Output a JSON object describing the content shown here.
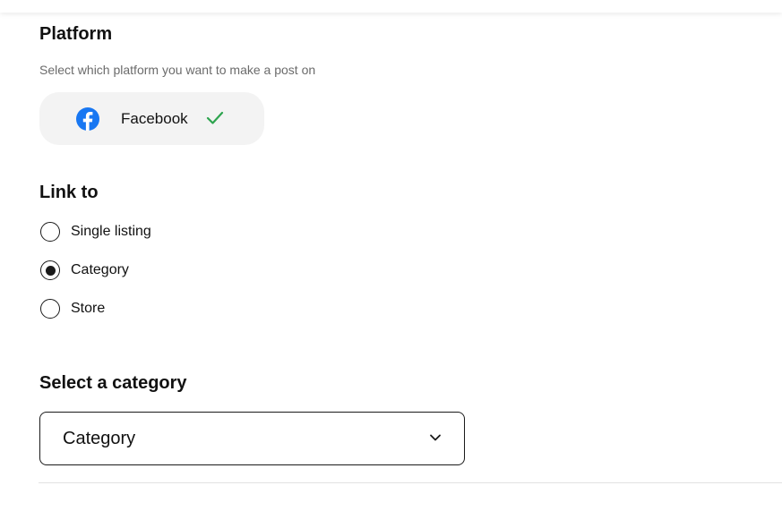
{
  "platform": {
    "heading": "Platform",
    "subtext": "Select which platform you want to make a post on",
    "selected_platform": {
      "label": "Facebook",
      "icon": "facebook-icon",
      "status_icon": "checkmark-icon",
      "brand_color": "#1877F2",
      "check_color": "#2DA44E"
    }
  },
  "link_to": {
    "heading": "Link to",
    "options": [
      {
        "label": "Single listing",
        "selected": false
      },
      {
        "label": "Category",
        "selected": true
      },
      {
        "label": "Store",
        "selected": false
      }
    ]
  },
  "category_select": {
    "heading": "Select a category",
    "value": "Category",
    "icon": "chevron-down-icon"
  }
}
